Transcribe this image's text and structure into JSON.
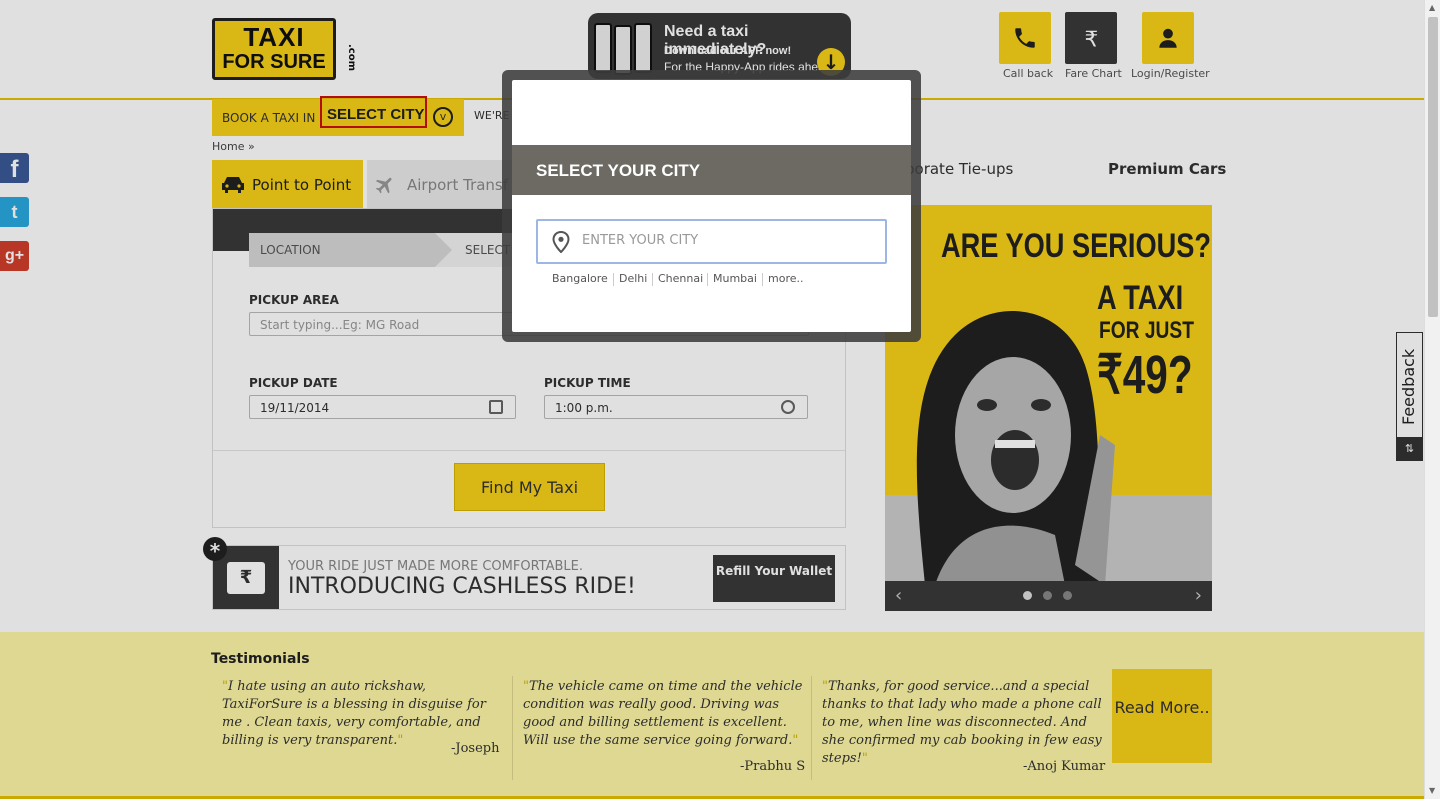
{
  "header": {
    "logo": {
      "line1": "TAXI",
      "line2": "FOR SURE",
      "suffix": ".com"
    },
    "app_banner": {
      "title": "Need a taxi immediately?",
      "line2": "Download our APP now!",
      "line3": "For the Happy-App rides ahead"
    },
    "buttons": [
      {
        "label": "Call back",
        "icon": "phone-icon",
        "bg": "#f7d21a"
      },
      {
        "label": "Fare Chart",
        "icon": "rupee-icon",
        "bg": "#3a3a3a"
      },
      {
        "label": "Login/Register",
        "icon": "user-icon",
        "bg": "#f7d21a"
      }
    ]
  },
  "book_bar": {
    "label": "BOOK A TAXI IN",
    "city": "SELECT CITY",
    "were_text": "WE'RE I"
  },
  "breadcrumb": {
    "home": "Home",
    "sep": "»"
  },
  "social": {
    "fb": "f",
    "tw": "t",
    "gp": "g+"
  },
  "tabs": {
    "point_to_point": "Point to Point",
    "airport": "Airport Transf",
    "corporate": "porate Tie-ups",
    "premium": "Premium Cars"
  },
  "form": {
    "steps": {
      "location": "LOCATION",
      "select": "SELECT"
    },
    "pickup_area_label": "PICKUP AREA",
    "pickup_area_placeholder": "Start typing...Eg: MG Road",
    "pickup_date_label": "PICKUP DATE",
    "pickup_date_value": "19/11/2014",
    "pickup_time_label": "PICKUP TIME",
    "pickup_time_value": "1:00 p.m.",
    "find_button": "Find My Taxi"
  },
  "cashless": {
    "star": "*",
    "line1": "YOUR RIDE JUST MADE MORE COMFORTABLE.",
    "line2": "INTRODUCING CASHLESS RIDE!",
    "refill_button": "Refill Your Wallet",
    "wallet_symbol": "₹"
  },
  "promo": {
    "line1": "ARE YOU SERIOUS?",
    "line2": "A TAXI",
    "line3": "FOR JUST",
    "line4": "₹49?",
    "prev": "‹",
    "next": "›",
    "slide_count": 3,
    "active_slide": 1
  },
  "testimonials": {
    "heading": "Testimonials",
    "items": [
      {
        "quote": "I hate using an auto rickshaw, TaxiForSure is a blessing in disguise for me . Clean taxis, very comfortable, and billing is very transparent.",
        "author": "-Joseph"
      },
      {
        "quote": "The vehicle came on time and the vehicle condition was really good. Driving was good and billing settlement is excellent. Will use the same service going forward.",
        "author": "-Prabhu S"
      },
      {
        "quote": "Thanks, for good service...and a special thanks to that lady who made a phone call to me, when line was disconnected. And she confirmed my cab booking in few easy steps!",
        "author": "-Anoj Kumar"
      }
    ],
    "read_more": "Read More.."
  },
  "feedback": {
    "label": "Feedback",
    "icon": "⇅"
  },
  "modal": {
    "title": "SELECT YOUR CITY",
    "input_placeholder": "ENTER YOUR CITY",
    "input_value": "",
    "quick_cities": [
      "Bangalore",
      "Delhi",
      "Chennai",
      "Mumbai",
      "more.."
    ]
  },
  "colors": {
    "brand_yellow": "#f7d21a",
    "dark": "#3a3a3a",
    "modal_header": "#6c6a63"
  }
}
